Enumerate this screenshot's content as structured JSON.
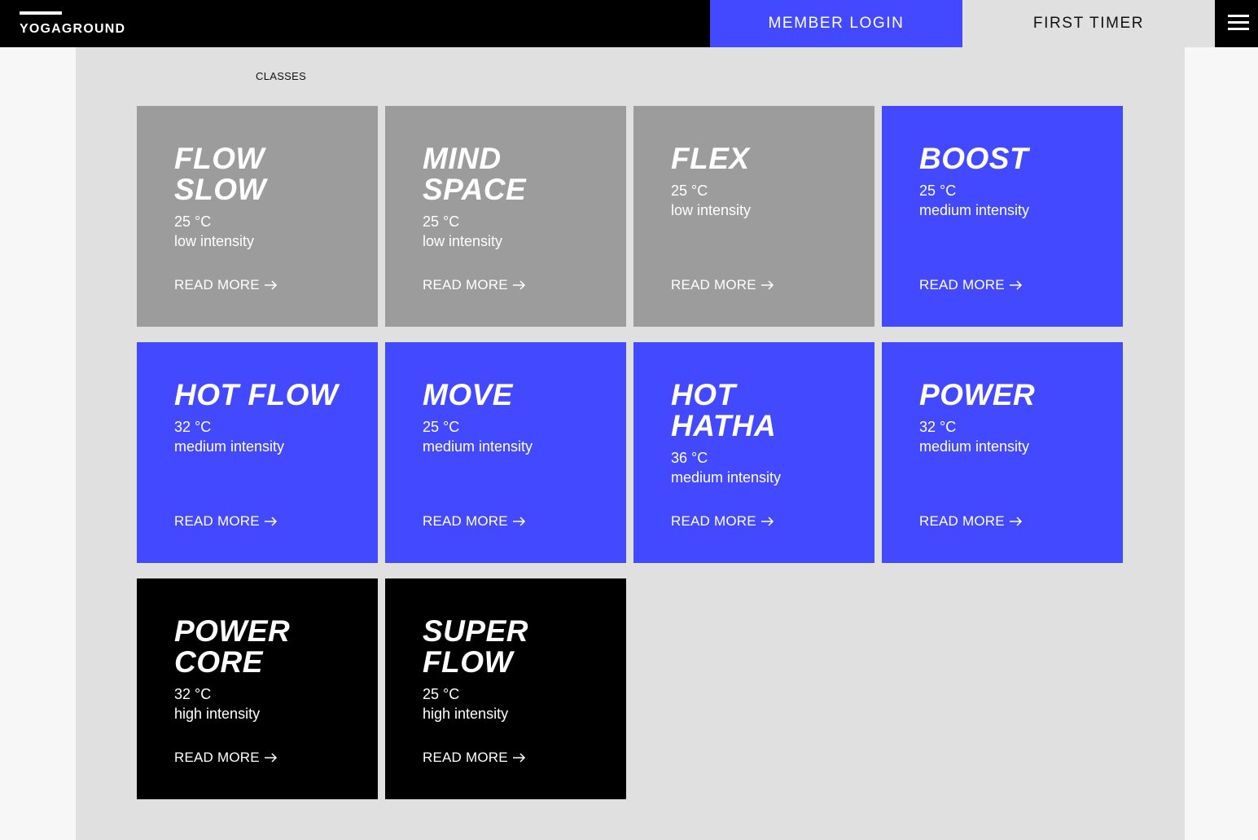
{
  "header": {
    "logo_text": "YOGAGROUND",
    "member_login": "MEMBER LOGIN",
    "first_timer": "FIRST TIMER",
    "menu_icon": "hamburger-menu-icon"
  },
  "main": {
    "section_label": "CLASSES",
    "read_more_label": "READ MORE",
    "arrow_icon": "arrow-right-icon",
    "cards": [
      {
        "title": "FLOW\nSLOW",
        "temperature": "25 °C",
        "intensity": "low intensity",
        "read_more": "READ MORE",
        "color": "#9c9c9c"
      },
      {
        "title": "MIND\nSPACE",
        "temperature": "25 °C",
        "intensity": "low intensity",
        "read_more": "READ MORE",
        "color": "#9c9c9c"
      },
      {
        "title": "FLEX",
        "temperature": "25 °C",
        "intensity": "low intensity",
        "read_more": "READ MORE",
        "color": "#9c9c9c"
      },
      {
        "title": "BOOST",
        "temperature": "25 °C",
        "intensity": "medium intensity",
        "read_more": "READ MORE",
        "color": "#4349ff"
      },
      {
        "title": "HOT FLOW",
        "temperature": "32 °C",
        "intensity": "medium intensity",
        "read_more": "READ MORE",
        "color": "#4349ff"
      },
      {
        "title": "MOVE",
        "temperature": "25 °C",
        "intensity": "medium intensity",
        "read_more": "READ MORE",
        "color": "#4349ff"
      },
      {
        "title": "HOT\nHATHA",
        "temperature": "36 °C",
        "intensity": "medium intensity",
        "read_more": "READ MORE",
        "color": "#4349ff"
      },
      {
        "title": "POWER",
        "temperature": "32 °C",
        "intensity": "medium intensity",
        "read_more": "READ MORE",
        "color": "#4349ff"
      },
      {
        "title": "POWER\nCORE",
        "temperature": "32 °C",
        "intensity": "high intensity",
        "read_more": "READ MORE",
        "color": "#000000"
      },
      {
        "title": "SUPER\nFLOW",
        "temperature": "25 °C",
        "intensity": "high intensity",
        "read_more": "READ MORE",
        "color": "#000000"
      }
    ]
  },
  "colors": {
    "accent": "#4349ff",
    "grey_card": "#9c9c9c",
    "black_card": "#000000",
    "panel_bg": "#e0e0e0"
  }
}
